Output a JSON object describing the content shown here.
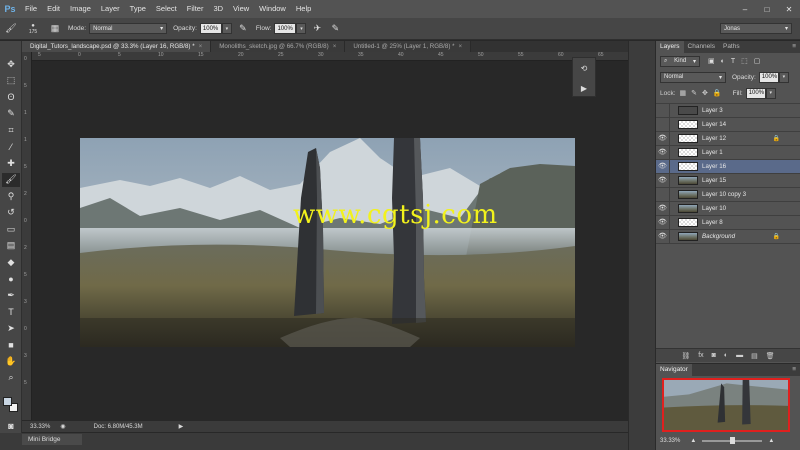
{
  "app": {
    "logo": "Ps"
  },
  "menu": [
    "File",
    "Edit",
    "Image",
    "Layer",
    "Type",
    "Select",
    "Filter",
    "3D",
    "View",
    "Window",
    "Help"
  ],
  "window_controls": [
    "–",
    "□",
    "✕"
  ],
  "options": {
    "brush_size": "175",
    "mode_label": "Mode:",
    "mode_value": "Normal",
    "opacity_label": "Opacity:",
    "opacity_value": "100%",
    "flow_label": "Flow:",
    "flow_value": "100%",
    "workspace": "Jonas"
  },
  "tabs": [
    {
      "label": "Digital_Tutors_landscape.psd @ 33.3% (Layer 16, RGB/8) *",
      "active": true
    },
    {
      "label": "Monoliths_sketch.jpg @ 66.7% (RGB/8)",
      "active": false
    },
    {
      "label": "Untitled-1 @ 25% (Layer 1, RGB/8) *",
      "active": false
    }
  ],
  "ruler_top": [
    "5",
    "0",
    "5",
    "10",
    "15",
    "20",
    "25",
    "30",
    "35",
    "40",
    "45",
    "50",
    "55",
    "60",
    "65"
  ],
  "ruler_left": [
    "0",
    "5",
    "1",
    "1",
    "5",
    "2",
    "0",
    "2",
    "5",
    "3",
    "0",
    "3",
    "5"
  ],
  "canvas": {
    "watermark": "www.cgtsj.com"
  },
  "status": {
    "zoom": "33.33%",
    "doc": "Doc: 6.80M/45.3M"
  },
  "mini_bridge": "Mini Bridge",
  "layers_panel": {
    "tabs": [
      "Layers",
      "Channels",
      "Paths"
    ],
    "kind": "Kind",
    "blend_mode": "Normal",
    "opacity_label": "Opacity:",
    "opacity_value": "100%",
    "lock_label": "Lock:",
    "fill_label": "Fill:",
    "fill_value": "100%",
    "layers": [
      {
        "name": "Layer 3",
        "visible": false,
        "thumb": "dark",
        "locked": false
      },
      {
        "name": "Layer 14",
        "visible": false,
        "thumb": "trans",
        "locked": false
      },
      {
        "name": "Layer 12",
        "visible": true,
        "thumb": "trans",
        "locked": true
      },
      {
        "name": "Layer 1",
        "visible": true,
        "thumb": "trans",
        "locked": false
      },
      {
        "name": "Layer 16",
        "visible": true,
        "thumb": "trans",
        "locked": false,
        "selected": true
      },
      {
        "name": "Layer 15",
        "visible": true,
        "thumb": "land",
        "locked": false
      },
      {
        "name": "Layer 10 copy 3",
        "visible": false,
        "thumb": "land",
        "locked": false
      },
      {
        "name": "Layer 10",
        "visible": true,
        "thumb": "land",
        "locked": false
      },
      {
        "name": "Layer 8",
        "visible": true,
        "thumb": "trans",
        "locked": false
      },
      {
        "name": "Background",
        "visible": true,
        "thumb": "land",
        "locked": true
      }
    ]
  },
  "navigator": {
    "title": "Navigator",
    "zoom": "33.33%"
  },
  "colors": {
    "watermark": "#f2f21c",
    "nav_frame": "#e0201e",
    "selected_layer": "#5a6a8a"
  }
}
